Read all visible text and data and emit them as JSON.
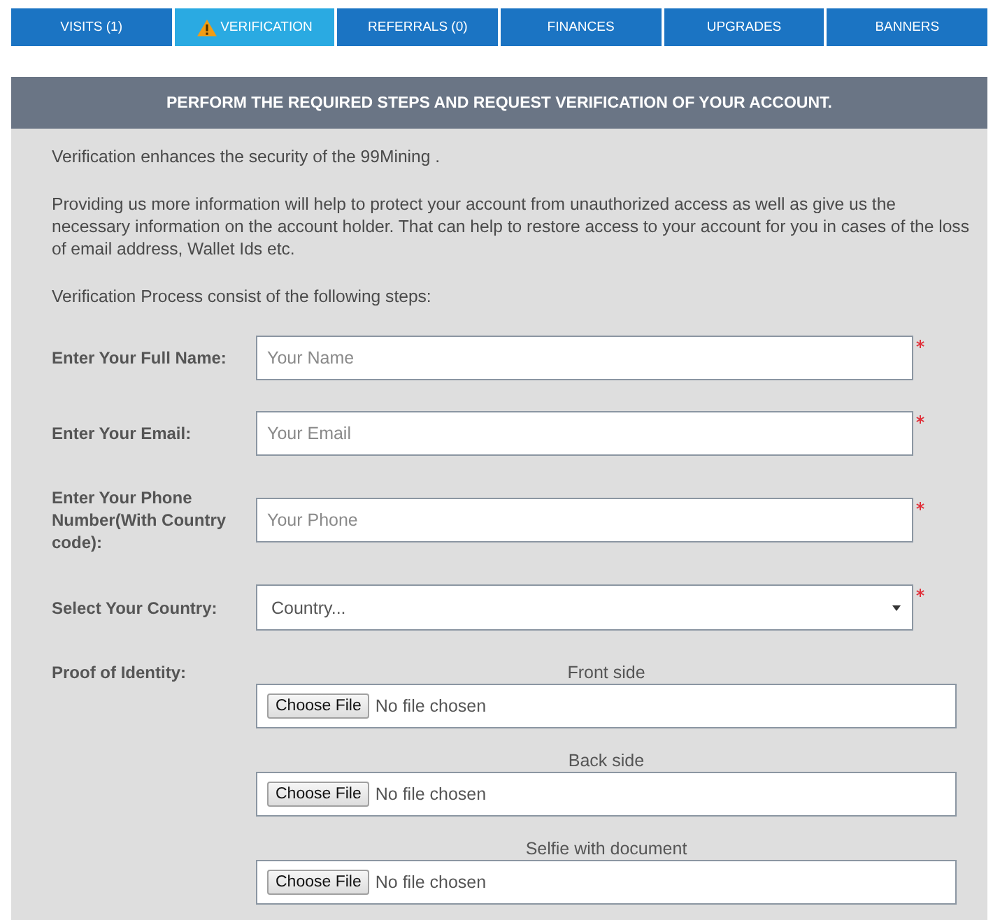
{
  "tabs": [
    {
      "label": "VISITS (1)",
      "selected": false,
      "warning": false
    },
    {
      "label": "VERIFICATION",
      "selected": true,
      "warning": true
    },
    {
      "label": "REFERRALS (0)",
      "selected": false,
      "warning": false
    },
    {
      "label": "FINANCES",
      "selected": false,
      "warning": false
    },
    {
      "label": "UPGRADES",
      "selected": false,
      "warning": false
    },
    {
      "label": "BANNERS",
      "selected": false,
      "warning": false
    }
  ],
  "panel": {
    "title": "PERFORM THE REQUIRED STEPS AND REQUEST VERIFICATION OF YOUR ACCOUNT.",
    "paragraphs": [
      "Verification enhances the security of the 99Mining .",
      "Providing us more information will help to protect your account from unauthorized access as well as give us the necessary information on the account holder. That can help to restore access to your account for you in cases of the loss of email address, Wallet Ids etc.",
      "Verification Process consist of the following steps:"
    ]
  },
  "form": {
    "fields": [
      {
        "kind": "text",
        "label": "Enter Your Full Name:",
        "placeholder": "Your Name",
        "required": true
      },
      {
        "kind": "text",
        "label": "Enter Your Email:",
        "placeholder": "Your Email",
        "required": true
      },
      {
        "kind": "text",
        "label": "Enter Your Phone Number(With Country code):",
        "placeholder": "Your Phone",
        "required": true
      },
      {
        "kind": "select",
        "label": "Select Your Country:",
        "value": "Country...",
        "required": true
      }
    ],
    "proof": {
      "label": "Proof of Identity:",
      "uploads": [
        {
          "caption": "Front side",
          "button": "Choose File",
          "status": "No file chosen"
        },
        {
          "caption": "Back side",
          "button": "Choose File",
          "status": "No file chosen"
        },
        {
          "caption": "Selfie with document",
          "button": "Choose File",
          "status": "No file chosen"
        }
      ]
    }
  }
}
